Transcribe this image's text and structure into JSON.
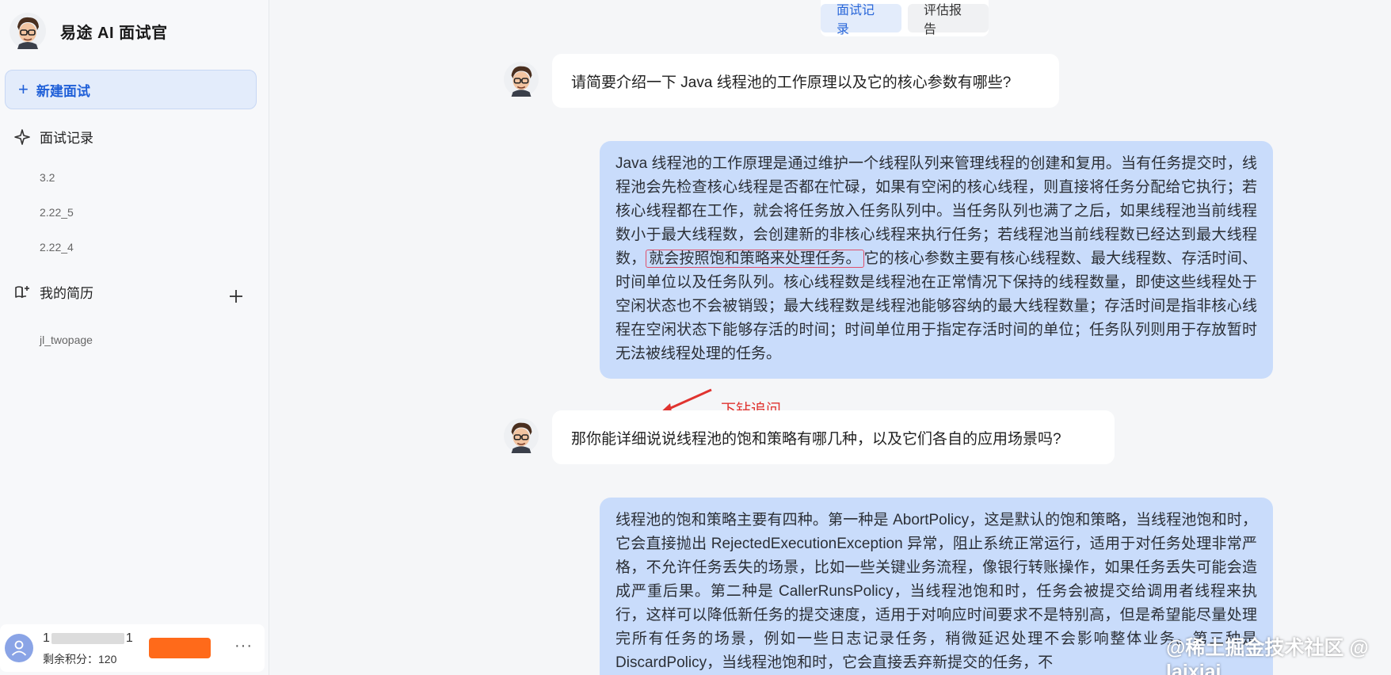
{
  "brand": {
    "title": "易途 AI 面试官"
  },
  "sidebar": {
    "new_interview_label": "新建面试",
    "records_label": "面试记录",
    "records": [
      "3.2",
      "2.22_5",
      "2.22_4"
    ],
    "resume_label": "我的简历",
    "resumes": [
      "jl_twopage"
    ]
  },
  "user": {
    "phone_prefix": "1",
    "phone_suffix": "1",
    "points_label": "剩余积分：",
    "points": "120",
    "more": "···"
  },
  "tabs": [
    {
      "label": "面试记录",
      "active": true
    },
    {
      "label": "评估报告",
      "active": false
    }
  ],
  "conversation": {
    "q1": "请简要介绍一下 Java 线程池的工作原理以及它的核心参数有哪些?",
    "a1_part1": "Java 线程池的工作原理是通过维护一个线程队列来管理线程的创建和复用。当有任务提交时，线程池会先检查核心线程是否都在忙碌，如果有空闲的核心线程，则直接将任务分配给它执行；若核心线程都在工作，就会将任务放入任务队列中。当任务队列也满了之后，如果线程池当前线程数小于最大线程数，会创建新的非核心线程来执行任务；若线程池当前线程数已经达到最大线程数，",
    "a1_highlight": "就会按照饱和策略来处理任务。",
    "a1_part2": "它的核心参数主要有核心线程数、最大线程数、存活时间、时间单位以及任务队列。核心线程数是线程池在正常情况下保持的线程数量，即使这些线程处于空闲状态也不会被销毁；最大线程数是线程池能够容纳的最大线程数量；存活时间是指非核心线程在空闲状态下能够存活的时间；时间单位用于指定存活时间的单位；任务队列则用于存放暂时无法被线程处理的任务。",
    "annotation": "下钻追问",
    "q2": "那你能详细说说线程池的饱和策略有哪几种，以及它们各自的应用场景吗?",
    "a2": "线程池的饱和策略主要有四种。第一种是 AbortPolicy，这是默认的饱和策略，当线程池饱和时，它会直接抛出 RejectedExecutionException 异常，阻止系统正常运行，适用于对任务处理非常严格，不允许任务丢失的场景，比如一些关键业务流程，像银行转账操作，如果任务丢失可能会造成严重后果。第二种是 CallerRunsPolicy，当线程池饱和时，任务会被提交给调用者线程来执行，这样可以降低新任务的提交速度，适用于对响应时间要求不是特别高，但是希望能尽量处理完所有任务的场景，例如一些日志记录任务，稍微延迟处理不会影响整体业务。第三种是 DiscardPolicy，当线程池饱和时，它会直接丢弃新提交的任务，不"
  },
  "watermark": "@稀土掘金技术社区 @ laixiai",
  "colors": {
    "accent": "#2a67d9",
    "answer_bubble": "#c9dcfb",
    "annotation": "#e0332f",
    "highlight_border": "#e0506b",
    "upgrade_button": "#ff6a1a"
  },
  "icons": [
    "ai-avatar",
    "sparkle-icon",
    "book-icon",
    "plus-icon",
    "user-icon",
    "arrow-icon"
  ]
}
